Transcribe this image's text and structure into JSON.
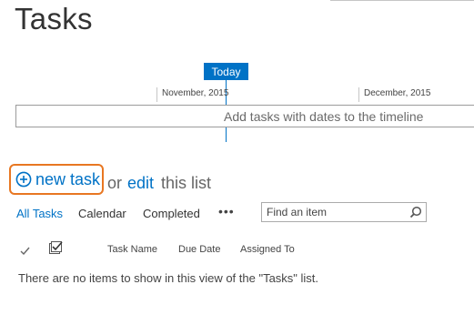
{
  "page": {
    "title": "Tasks"
  },
  "timeline": {
    "today_label": "Today",
    "months": [
      "November, 2015",
      "December, 2015"
    ],
    "empty_text": "Add tasks with dates to the timeline"
  },
  "actions": {
    "new_task_label": "new task",
    "or_text": "or",
    "edit_label": "edit",
    "this_list_text": "this list"
  },
  "views": {
    "items": [
      "All Tasks",
      "Calendar",
      "Completed"
    ],
    "active": "All Tasks",
    "more_label": "•••"
  },
  "search": {
    "placeholder": "Find an item"
  },
  "list": {
    "columns": [
      "Task Name",
      "Due Date",
      "Assigned To"
    ],
    "empty_message": "There are no items to show in this view of the \"Tasks\" list."
  },
  "colors": {
    "accent": "#0072c6",
    "highlight": "#e87722"
  },
  "icons": [
    "plus-circle-icon",
    "search-icon",
    "checkmark-icon",
    "select-all-icon",
    "more-icon"
  ]
}
